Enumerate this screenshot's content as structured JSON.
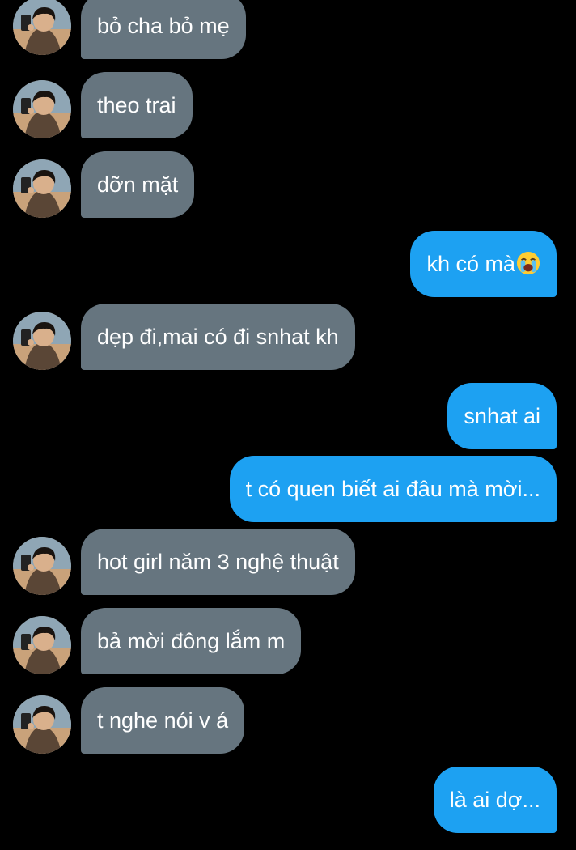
{
  "messages": [
    {
      "side": "in",
      "text": "bỏ cha bỏ mẹ"
    },
    {
      "side": "in",
      "text": "theo trai"
    },
    {
      "side": "in",
      "text": "dỡn mặt"
    },
    {
      "side": "out",
      "text": "kh có mà",
      "emoji": "loudly-crying-face-icon"
    },
    {
      "side": "in",
      "text": "dẹp đi,mai có đi snhat kh"
    },
    {
      "side": "out",
      "text": "snhat ai"
    },
    {
      "side": "out",
      "text": "t có quen biết ai đâu mà mời..."
    },
    {
      "side": "in",
      "text": "hot girl năm 3 nghệ thuật"
    },
    {
      "side": "in",
      "text": "bả mời đông lắm m"
    },
    {
      "side": "in",
      "text": "t nghe nói v á"
    },
    {
      "side": "out",
      "text": "là ai dợ..."
    }
  ],
  "colors": {
    "background": "#000000",
    "incoming_bubble": "#66757f",
    "outgoing_bubble": "#1da1f2",
    "text": "#ffffff"
  },
  "icons": {
    "avatar": "profile-photo-avatar"
  }
}
